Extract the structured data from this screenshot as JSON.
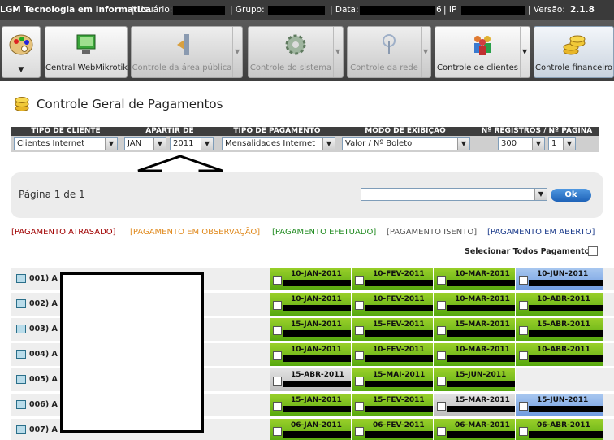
{
  "topbar": {
    "company": "LGM Tecnologia em Informatica",
    "user_label": "| Usuário:",
    "group_label": "| Grupo:",
    "date_label": "| Data:",
    "date_tail": "6",
    "ip_label": "| IP",
    "version_label": "| Versão:",
    "version": "2.1.8"
  },
  "toolbar": {
    "items": [
      {
        "label": "",
        "icon": "palette-icon"
      },
      {
        "label": "Central WebMikrotik",
        "icon": "monitor-icon"
      },
      {
        "label": "Controle da área pública",
        "icon": "public-area-icon"
      },
      {
        "label": "Controle do sistema",
        "icon": "gear-icon"
      },
      {
        "label": "Controle da rede",
        "icon": "antenna-icon"
      },
      {
        "label": "Controle de clientes",
        "icon": "users-icon"
      },
      {
        "label": "Controle financeiro",
        "icon": "coins-icon"
      }
    ]
  },
  "page": {
    "title": "Controle Geral de Pagamentos"
  },
  "filters": {
    "client_type": {
      "header": "TIPO DE CLIENTE",
      "value": "Clientes Internet"
    },
    "from": {
      "header": "APARTIR DE",
      "month": "JAN",
      "year": "2011"
    },
    "payment_type": {
      "header": "TIPO DE PAGAMENTO",
      "value": "Mensalidades Internet"
    },
    "display_mode": {
      "header": "MODO DE EXIBIÇÃO",
      "value": "Valor / Nº Boleto"
    },
    "records": {
      "header": "Nº REGISTROS / Nº PÁGINA",
      "per_page": "300",
      "page": "1"
    }
  },
  "pager": {
    "text": "Página 1 de 1",
    "ok_label": "Ok"
  },
  "legend": {
    "late": "[PAGAMENTO ATRASADO]",
    "observation": "[PAGAMENTO EM OBSERVAÇÃO]",
    "done": "[PAGAMENTO EFETUADO]",
    "exempt": "[PAGAMENTO ISENTO]",
    "open": "[PAGAMENTO EM ABERTO]"
  },
  "select_all_label": "Selecionar Todos Pagamentos",
  "colors": {
    "late": "#a00000",
    "observation": "#e08a1e",
    "done": "#1f8a1f",
    "exempt": "#555555",
    "open": "#1a3a8a"
  },
  "rows": [
    {
      "num": "001)",
      "letter": "A",
      "payments": [
        [
          "10-JAN-2011",
          "green"
        ],
        [
          "10-FEV-2011",
          "green"
        ],
        [
          "10-MAR-2011",
          "green"
        ],
        [
          "10-JUN-2011",
          "blue"
        ]
      ]
    },
    {
      "num": "002)",
      "letter": "A",
      "payments": [
        [
          "10-JAN-2011",
          "green"
        ],
        [
          "10-FEV-2011",
          "green"
        ],
        [
          "10-MAR-2011",
          "green"
        ],
        [
          "10-ABR-2011",
          "green"
        ]
      ]
    },
    {
      "num": "003)",
      "letter": "A",
      "payments": [
        [
          "15-JAN-2011",
          "green"
        ],
        [
          "15-FEV-2011",
          "green"
        ],
        [
          "15-MAR-2011",
          "green"
        ],
        [
          "15-ABR-2011",
          "green"
        ]
      ]
    },
    {
      "num": "004)",
      "letter": "A",
      "payments": [
        [
          "10-JAN-2011",
          "green"
        ],
        [
          "10-FEV-2011",
          "green"
        ],
        [
          "10-MAR-2011",
          "green"
        ],
        [
          "10-ABR-2011",
          "green"
        ]
      ]
    },
    {
      "num": "005)",
      "letter": "A",
      "payments": [
        [
          "15-ABR-2011",
          "gray"
        ],
        [
          "15-MAI-2011",
          "green"
        ],
        [
          "15-JUN-2011",
          "green"
        ]
      ]
    },
    {
      "num": "006)",
      "letter": "A",
      "payments": [
        [
          "15-JAN-2011",
          "green"
        ],
        [
          "15-FEV-2011",
          "green"
        ],
        [
          "15-MAR-2011",
          "gray"
        ],
        [
          "15-JUN-2011",
          "blue"
        ]
      ]
    },
    {
      "num": "007)",
      "letter": "A",
      "payments": [
        [
          "06-JAN-2011",
          "green"
        ],
        [
          "06-FEV-2011",
          "green"
        ],
        [
          "06-MAR-2011",
          "green"
        ],
        [
          "06-ABR-2011",
          "green"
        ]
      ]
    }
  ]
}
